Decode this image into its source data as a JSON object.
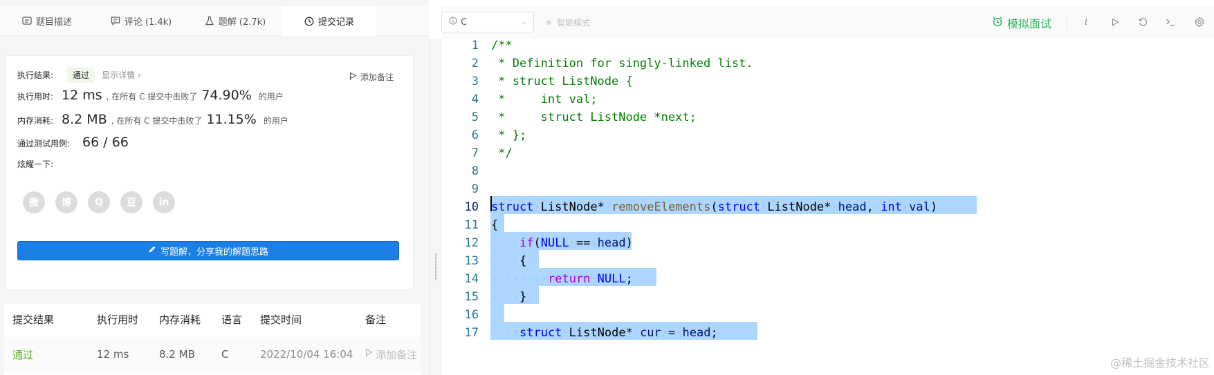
{
  "tabs": [
    {
      "label": "题目描述",
      "icon": "description-icon"
    },
    {
      "label": "评论 (1.4k)",
      "icon": "comment-icon"
    },
    {
      "label": "题解 (2.7k)",
      "icon": "flask-icon"
    },
    {
      "label": "提交记录",
      "icon": "clock-icon"
    }
  ],
  "result": {
    "label": "执行结果:",
    "status": "通过",
    "detail_link": "显示详情 ›",
    "add_note": "添加备注",
    "time_label": "执行用时:",
    "time_value": "12 ms",
    "time_desc": ", 在所有 C 提交中击败了",
    "time_pct": "74.90%",
    "users": "的用户",
    "mem_label": "内存消耗:",
    "mem_value": "8.2 MB",
    "mem_desc": ", 在所有 C 提交中击败了",
    "mem_pct": "11.15%",
    "tests_label": "通过测试用例:",
    "tests_value": "66 / 66",
    "share_label": "炫耀一下:",
    "share_icons": [
      "wechat-icon",
      "weibo-icon",
      "qq-icon",
      "douban-icon",
      "linkedin-icon"
    ],
    "share_glyphs": [
      "微",
      "博",
      "Q",
      "豆",
      "in"
    ],
    "write_button": "写题解，分享我的解题思路"
  },
  "table": {
    "headers": [
      "提交结果",
      "执行用时",
      "内存消耗",
      "语言",
      "提交时间",
      "备注"
    ],
    "rows": [
      {
        "result": "通过",
        "time": "12 ms",
        "memory": "8.2 MB",
        "lang": "C",
        "submitted": "2022/10/04 16:04",
        "note": "添加备注"
      }
    ]
  },
  "toolbar": {
    "language": "C",
    "smart_mode": "智能模式",
    "interview": "模拟面试",
    "tools": [
      "info-icon",
      "play-icon",
      "reset-icon",
      "terminal-icon",
      "settings-icon"
    ]
  },
  "editor": {
    "line_numbers": [
      "1",
      "2",
      "3",
      "4",
      "5",
      "6",
      "7",
      "8",
      "9",
      "10",
      "11",
      "12",
      "13",
      "14",
      "15",
      "16",
      "17"
    ],
    "current_line": "10",
    "lines": [
      "/**",
      " * Definition for singly-linked list.",
      " * struct ListNode {",
      " *     int val;",
      " *     struct ListNode *next;",
      " * };",
      " */",
      "",
      "",
      "struct ListNode* removeElements(struct ListNode* head, int val)",
      "{",
      "    if(NULL == head)",
      "    {",
      "        return NULL;",
      "    }",
      "",
      "    struct ListNode* cur = head;"
    ]
  },
  "watermark": "@稀土掘金技术社区",
  "colors": {
    "accent_blue": "#1a7fe7",
    "success_green": "#5cb325",
    "interview_green": "#2db55d",
    "selection": "#add6ff"
  }
}
